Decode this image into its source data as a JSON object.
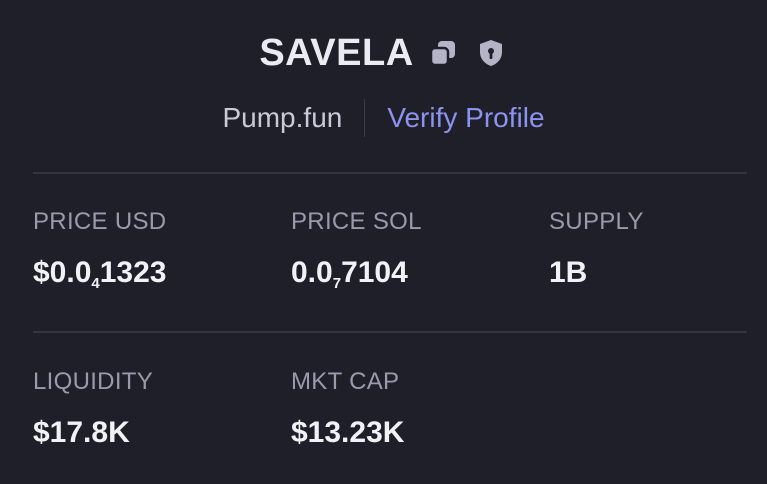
{
  "token": {
    "name": "SAVELA",
    "platform": "Pump.fun",
    "verify_label": "Verify Profile"
  },
  "icons": {
    "copy": "copy-icon",
    "shield": "shield-icon"
  },
  "stats_row1": [
    {
      "label": "PRICE USD",
      "value_prefix": "$0.0",
      "value_sub": "4",
      "value_suffix": "1323"
    },
    {
      "label": "PRICE SOL",
      "value_prefix": "0.0",
      "value_sub": "7",
      "value_suffix": "7104"
    },
    {
      "label": "SUPPLY",
      "value": "1B"
    }
  ],
  "stats_row2": [
    {
      "label": "LIQUIDITY",
      "value": "$17.8K"
    },
    {
      "label": "MKT CAP",
      "value": "$13.23K"
    }
  ],
  "colors": {
    "background": "#1f1f29",
    "accent": "#8c93ee",
    "label": "#9a9aae",
    "divider": "#34343f"
  }
}
